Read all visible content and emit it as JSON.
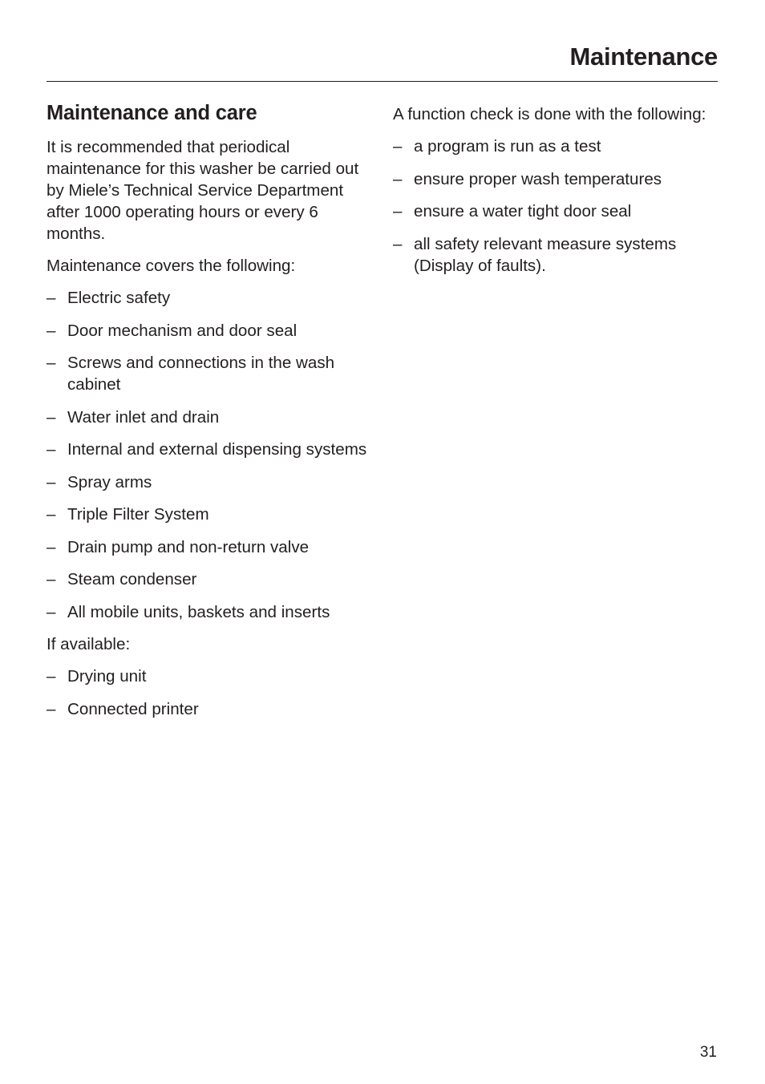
{
  "header": {
    "title": "Maintenance"
  },
  "left_column": {
    "section_title": "Maintenance and care",
    "intro": "It is recommended that periodical maintenance for this washer be carried out by Miele’s Technical Service Department after 1000 operating hours or every 6 months.",
    "covers_label": "Maintenance covers the following:",
    "covers_items": [
      "Electric safety",
      "Door mechanism and door seal",
      "Screws and connections in the wash cabinet",
      "Water inlet and drain",
      "Internal and external dispensing systems",
      "Spray arms",
      "Triple Filter System",
      "Drain pump and non-return valve",
      "Steam condenser",
      "All mobile units, baskets and inserts"
    ],
    "if_available_label": "If available:",
    "if_available_items": [
      "Drying unit",
      "Connected printer"
    ]
  },
  "right_column": {
    "intro": "A function check is done with the following:",
    "items": [
      "a program is run as a test",
      "ensure proper wash temperatures",
      "ensure a water tight door seal",
      "all safety relevant measure systems (Display of faults)."
    ]
  },
  "list_marker": "–",
  "footer": {
    "page_number": "31"
  }
}
